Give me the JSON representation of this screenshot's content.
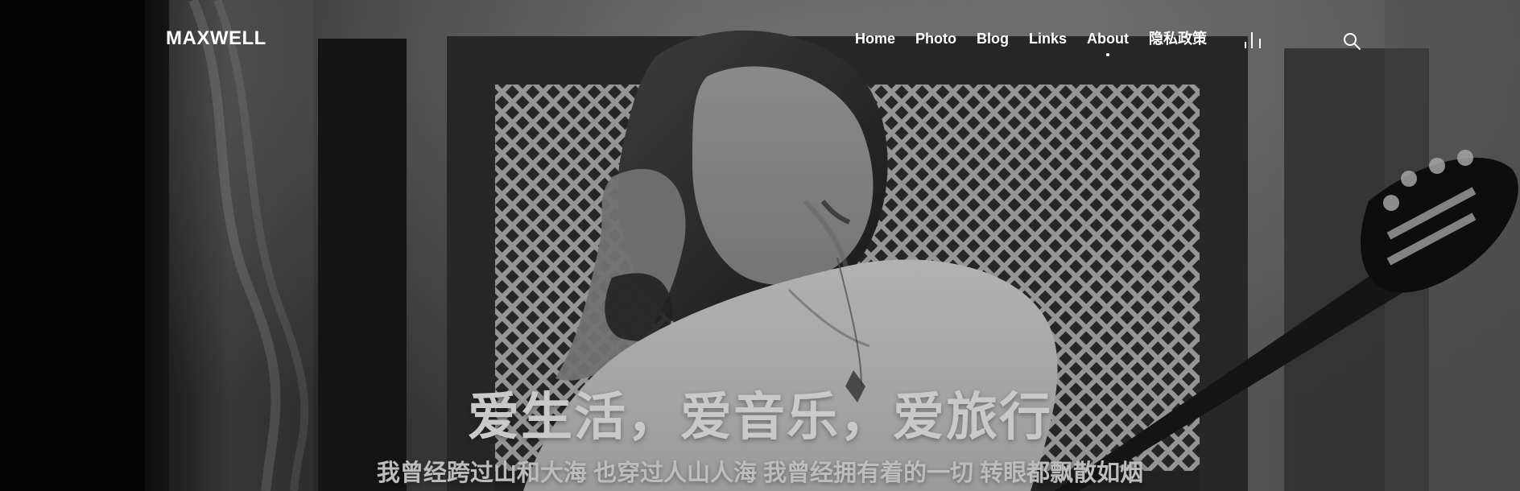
{
  "header": {
    "brand": "MAXWELL",
    "nav": [
      {
        "label": "Home"
      },
      {
        "label": "Photo"
      },
      {
        "label": "Blog"
      },
      {
        "label": "Links"
      },
      {
        "label": "About"
      },
      {
        "label": "隐私政策"
      }
    ],
    "active_nav": "About",
    "icons": [
      "bars-icon",
      "search-icon"
    ]
  },
  "hero": {
    "title": "爱生活，爱音乐，爱旅行",
    "subtitle": "我曾经跨过山和大海 也穿过人山人海 我曾经拥有着的一切 转眼都飘散如烟",
    "image": "black-and-white photo of a woman playing guitar"
  },
  "colors": {
    "text_primary": "#ffffff",
    "title_text": "#c9c9c9",
    "subtitle_text": "#bdbdbd"
  }
}
